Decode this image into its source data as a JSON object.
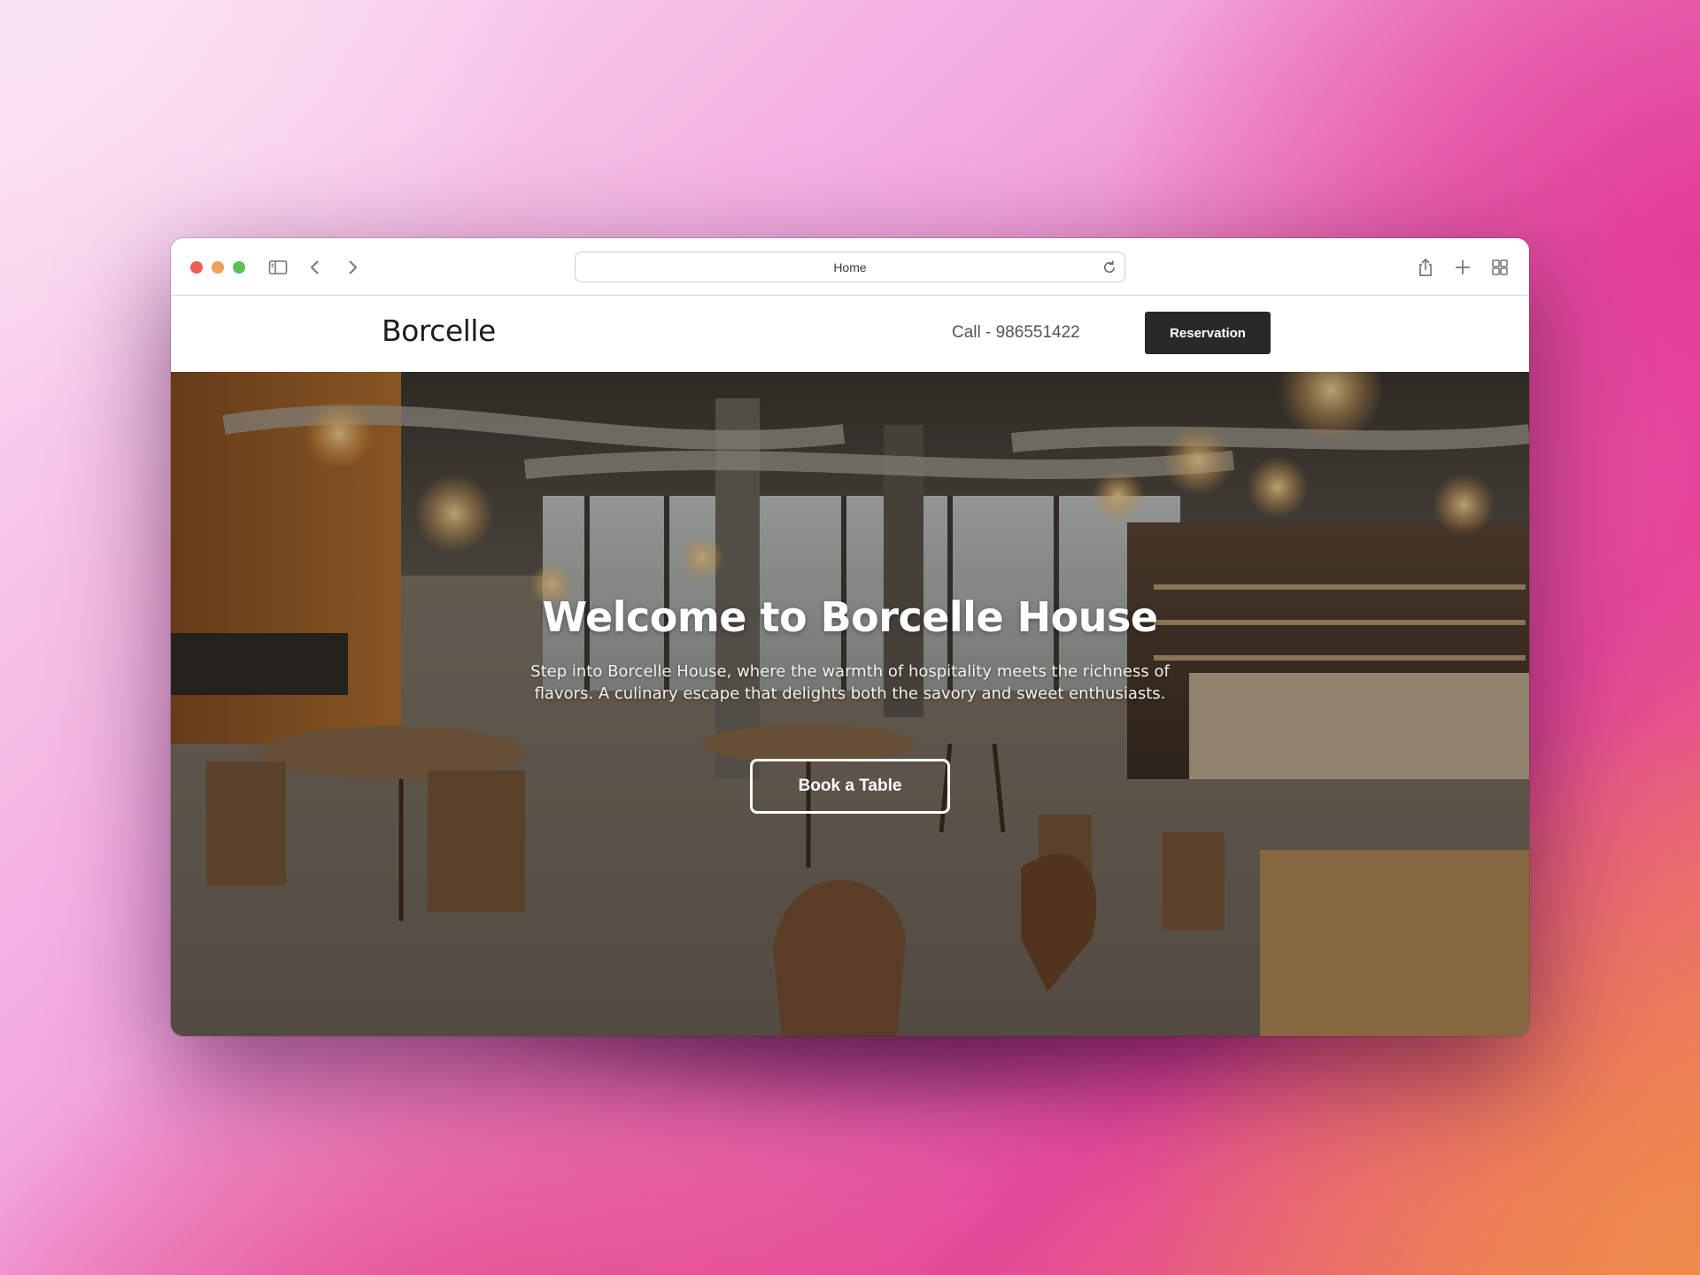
{
  "browser": {
    "url_text": "Home",
    "icons": [
      "sidebar-icon",
      "back-icon",
      "forward-icon",
      "reload-icon",
      "share-icon",
      "new-tab-icon",
      "tab-overview-icon"
    ]
  },
  "header": {
    "logo": "Borcelle",
    "phone": "Call - 986551422",
    "reservation_label": "Reservation"
  },
  "hero": {
    "title": "Welcome to Borcelle House",
    "subtitle": "Step into Borcelle House, where the warmth of hospitality meets the richness of flavors. A culinary escape that delights both the savory and sweet enthusiasts.",
    "cta_label": "Book a Table"
  },
  "colors": {
    "reservation_bg": "#262a29",
    "traffic_red": "#ec5f57",
    "traffic_yellow": "#e9a15d",
    "traffic_green": "#5bc05a"
  }
}
